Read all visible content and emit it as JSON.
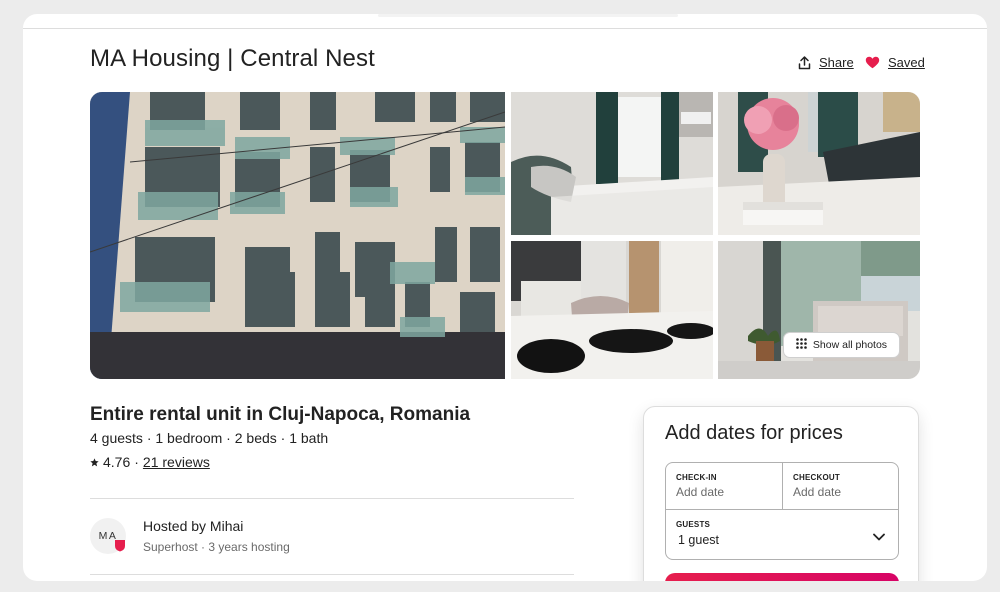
{
  "listing": {
    "title": "MA Housing | Central Nest",
    "type_heading": "Entire rental unit in Cluj-Napoca, Romania",
    "details": "4 guests · 1 bedroom · 2 beds · 1 bath",
    "rating": "4.76",
    "rating_separator": "·",
    "reviews_link": "21 reviews"
  },
  "actions": {
    "share_label": "Share",
    "saved_label": "Saved",
    "saved_icon": "heart-filled-icon",
    "share_icon": "share-upload-icon"
  },
  "gallery": {
    "show_all_label": "Show all photos",
    "photos": [
      "building-exterior",
      "bedroom",
      "flowers-living-room",
      "kitchen-dining",
      "balcony-plant"
    ]
  },
  "host": {
    "avatar_initials": "MA",
    "name_line": "Hosted by Mihai",
    "meta_line": "Superhost · 3 years hosting"
  },
  "booking": {
    "heading": "Add dates for prices",
    "checkin_label": "CHECK-IN",
    "checkin_value": "Add date",
    "checkout_label": "CHECKOUT",
    "checkout_value": "Add date",
    "guests_label": "GUESTS",
    "guests_value": "1 guest"
  },
  "colors": {
    "brand": "#e61e4d",
    "text": "#222222",
    "muted": "#6a6a6a",
    "border": "#dddddd"
  }
}
